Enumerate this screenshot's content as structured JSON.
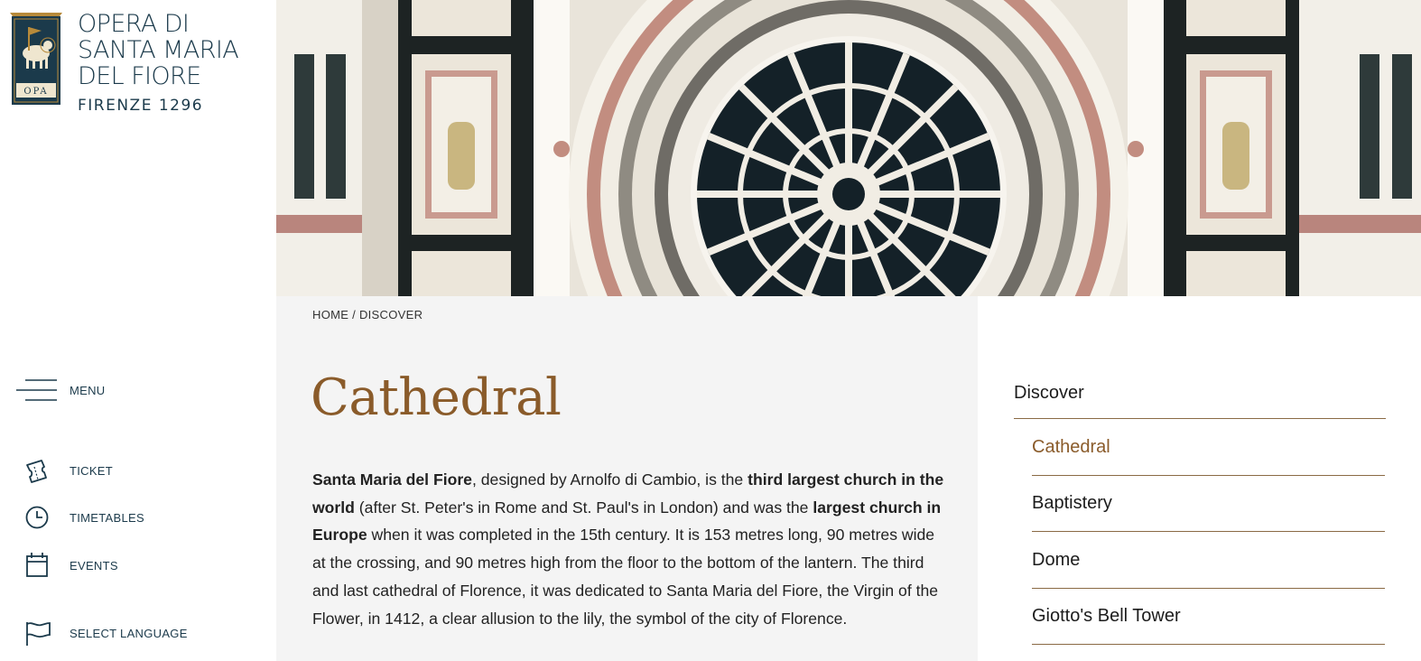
{
  "logo": {
    "line1": "OPERA DI",
    "line2": "SANTA MARIA",
    "line3": "DEL FIORE",
    "sub": "FIRENZE 1296",
    "crest_text": "OPA"
  },
  "sidebar": {
    "menu_label": "MENU",
    "items": [
      {
        "label": "TICKET",
        "icon": "ticket-icon"
      },
      {
        "label": "TIMETABLES",
        "icon": "clock-icon"
      },
      {
        "label": "EVENTS",
        "icon": "calendar-icon"
      },
      {
        "label": "SELECT LANGUAGE",
        "icon": "flag-icon"
      }
    ]
  },
  "breadcrumb": {
    "home": "HOME",
    "separator": " / ",
    "current": "DISCOVER"
  },
  "page": {
    "title": "Cathedral",
    "body_parts": [
      {
        "text": "Santa Maria del Fiore",
        "bold": true
      },
      {
        "text": ", designed by Arnolfo di Cambio, is the ",
        "bold": false
      },
      {
        "text": "third largest church in the world",
        "bold": true
      },
      {
        "text": " (after St. Peter's in Rome and St. Paul's in London) and was the ",
        "bold": false
      },
      {
        "text": "largest church in Europe",
        "bold": true
      },
      {
        "text": " when it was completed in the 15th century. It is 153 metres long, 90 metres wide at the crossing, and 90 metres high from the floor to the bottom of the lantern. The third and last cathedral of Florence, it was dedicated to Santa Maria del Fiore, the Virgin of the Flower, in 1412, a clear allusion to the lily, the symbol of the city of Florence.",
        "bold": false
      }
    ]
  },
  "rightnav": {
    "heading": "Discover",
    "items": [
      "Cathedral",
      "Baptistery",
      "Dome",
      "Giotto's Bell Tower"
    ],
    "active_index": 0
  },
  "colors": {
    "accent": "#8a5b2a",
    "navy": "#1b3a4b",
    "content_bg": "#f4f4f4",
    "rule": "#8a6a45"
  }
}
